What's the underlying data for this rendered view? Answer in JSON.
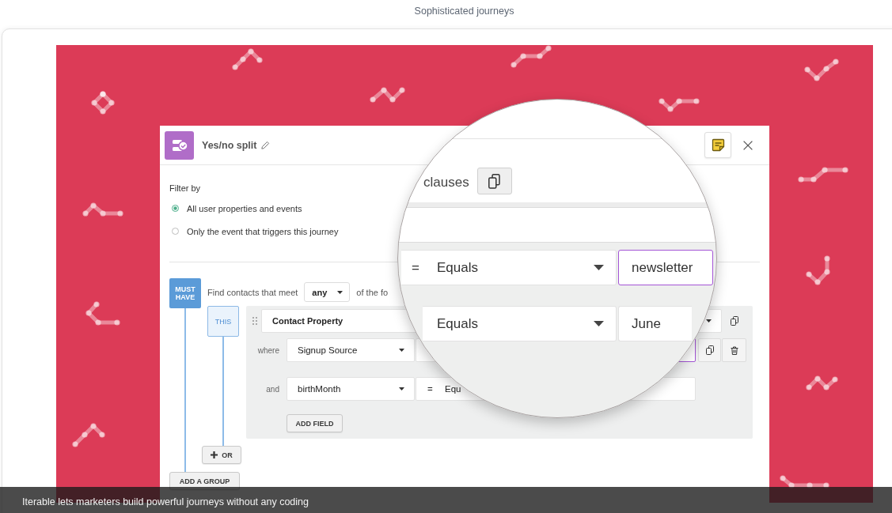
{
  "page": {
    "title": "Sophisticated journeys"
  },
  "app_window": {
    "title": "Yes/no split",
    "filter": {
      "label": "Filter by",
      "options": [
        {
          "label": "All user properties and events",
          "selected": true
        },
        {
          "label": "Only the event that triggers this journey",
          "selected": false
        }
      ]
    },
    "group": {
      "badge": "MUST HAVE",
      "match_prefix": "Find contacts that meet",
      "match_value": "any",
      "match_suffix": "of the fo",
      "clause": {
        "badge": "THIS",
        "source": "Contact Property",
        "fields": [
          {
            "connector": "where",
            "property": "Signup Source",
            "value_focused": true,
            "has_actions": true
          },
          {
            "connector": "and",
            "property": "birthMonth",
            "operator_symbol": "=",
            "operator": "Equ",
            "value_focused": false,
            "has_actions": false
          }
        ],
        "add_field": "ADD FIELD"
      },
      "or_button": "OR",
      "add_group": "ADD A GROUP"
    }
  },
  "magnifier": {
    "heading": "clauses",
    "rows": [
      {
        "operator_symbol": "=",
        "operator": "Equals",
        "value": "newsletter",
        "focused": true
      },
      {
        "operator": "Equals",
        "value": "June",
        "focused": false
      }
    ]
  },
  "caption": "Iterable lets marketers build powerful journeys without any coding"
}
